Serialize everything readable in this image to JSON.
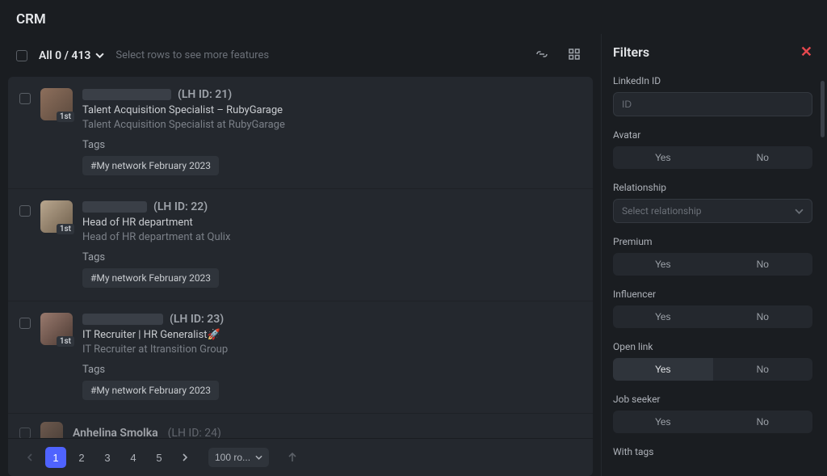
{
  "page": {
    "title": "CRM"
  },
  "toolbar": {
    "counter": "All 0 / 413",
    "hint": "Select rows to see more features"
  },
  "contacts": [
    {
      "lhid": "(LH ID: 21)",
      "degree": "1st",
      "headline": "Talent Acquisition Specialist – RubyGarage",
      "subline": "Talent Acquisition Specialist at RubyGarage",
      "tags_label": "Tags",
      "tag": "#My network February 2023"
    },
    {
      "lhid": "(LH ID: 22)",
      "degree": "1st",
      "headline": "Head of HR department",
      "subline": "Head of HR department at Qulix",
      "tags_label": "Tags",
      "tag": "#My network February 2023"
    },
    {
      "lhid": "(LH ID: 23)",
      "degree": "1st",
      "headline": "IT Recruiter | HR Generalist🚀",
      "subline": "IT Recruiter at Itransition Group",
      "tags_label": "Tags",
      "tag": "#My network February 2023"
    }
  ],
  "peek": {
    "name": "Anhelina Smolka",
    "lhid": "(LH ID: 24)"
  },
  "pager": {
    "pages": [
      "1",
      "2",
      "3",
      "4",
      "5"
    ],
    "size_label": "100 ro..."
  },
  "filters": {
    "title": "Filters",
    "linkedin_id": {
      "label": "LinkedIn ID",
      "placeholder": "ID"
    },
    "avatar": {
      "label": "Avatar",
      "yes": "Yes",
      "no": "No"
    },
    "relationship": {
      "label": "Relationship",
      "placeholder": "Select relationship"
    },
    "premium": {
      "label": "Premium",
      "yes": "Yes",
      "no": "No"
    },
    "influencer": {
      "label": "Influencer",
      "yes": "Yes",
      "no": "No"
    },
    "open_link": {
      "label": "Open link",
      "yes": "Yes",
      "no": "No"
    },
    "job_seeker": {
      "label": "Job seeker",
      "yes": "Yes",
      "no": "No"
    },
    "with_tags": {
      "label": "With tags"
    }
  }
}
